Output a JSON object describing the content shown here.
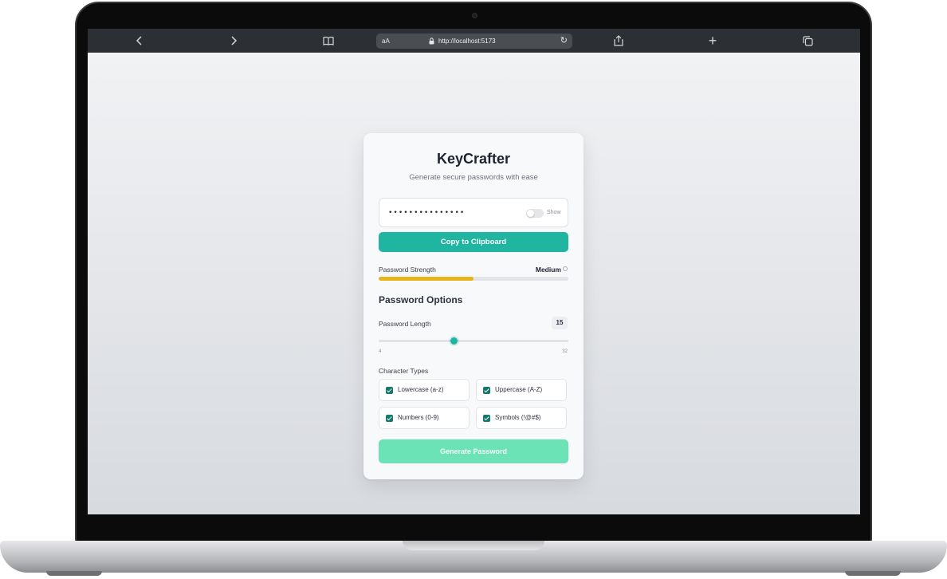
{
  "browser": {
    "text_size_label": "aA",
    "url": "http://localhost:5173",
    "icons": {
      "back": "chevron-left-icon",
      "forward": "chevron-right-icon",
      "reader": "book-icon",
      "lock": "lock-icon",
      "reload": "reload-icon",
      "share": "share-icon",
      "new_tab": "plus-icon",
      "tabs": "tabs-icon"
    }
  },
  "app": {
    "title": "KeyCrafter",
    "subtitle": "Generate secure passwords with ease",
    "password": {
      "masked_value": "•••••••••••••••",
      "show_label": "Show",
      "show_enabled": false
    },
    "copy_button": "Copy to Clipboard",
    "strength": {
      "label": "Password Strength",
      "value": "Medium",
      "level": 0.5,
      "color": "#e9b31a"
    },
    "options": {
      "heading": "Password Options",
      "length_label": "Password Length",
      "length_value": "15",
      "length_min": "4",
      "length_max": "32",
      "length_current": 15,
      "types_label": "Character Types",
      "types": [
        {
          "label": "Lowercase (a-z)",
          "checked": true
        },
        {
          "label": "Uppercase (A-Z)",
          "checked": true
        },
        {
          "label": "Numbers (0-9)",
          "checked": true
        },
        {
          "label": "Symbols (!@#$)",
          "checked": true
        }
      ]
    },
    "generate_button": "Generate Password",
    "accent_color": "#1fb5a0"
  }
}
